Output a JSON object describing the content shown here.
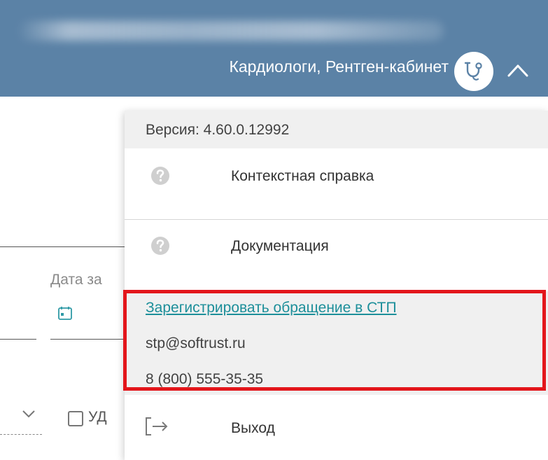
{
  "header": {
    "user_departments": "Кардиологи, Рентген-кабинет",
    "avatar_icon": "stethoscope-icon",
    "collapse_icon": "chevron-up-icon",
    "background_color": "#5b82a6"
  },
  "background_form": {
    "date_label": "Дата за",
    "calendar_icon": "calendar-icon",
    "checkbox_label": "УД",
    "dropdown_icon": "chevron-down-icon"
  },
  "menu": {
    "version": "Версия: 4.60.0.12992",
    "items": [
      {
        "label": "Контекстная справка",
        "icon": "help-circle-icon"
      },
      {
        "label": "Документация",
        "icon": "help-circle-icon"
      }
    ],
    "support": {
      "link_label": "Зарегистрировать обращение в СТП",
      "email": "stp@softrust.ru",
      "phone": "8 (800) 555-35-35",
      "link_color": "#1d8f9a"
    },
    "exit": {
      "label": "Выход",
      "icon": "logout-icon"
    }
  },
  "annotation": {
    "highlight_color": "#e3161b"
  }
}
